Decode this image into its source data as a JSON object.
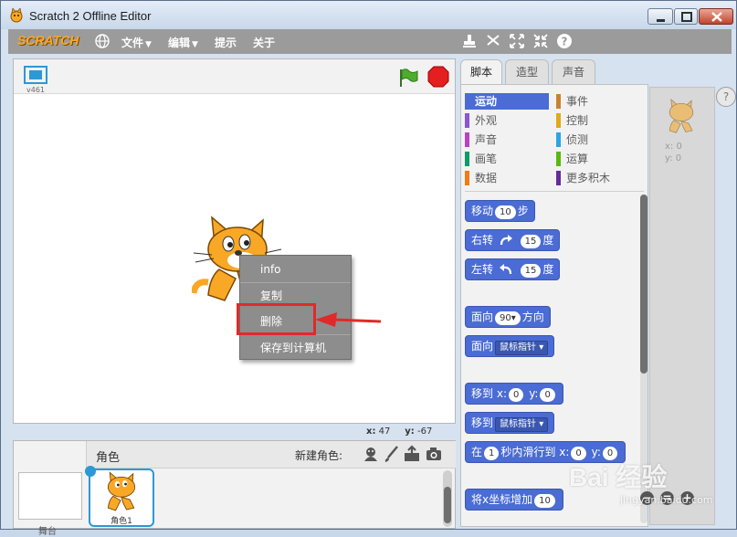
{
  "window": {
    "title": "Scratch 2 Offline Editor"
  },
  "menubar": {
    "logo": "SCRATCH",
    "items": [
      "文件",
      "编辑",
      "提示",
      "关于"
    ]
  },
  "stage": {
    "version": "v461",
    "coords": {
      "x_label": "x:",
      "x_value": "47",
      "y_label": "y:",
      "y_value": "-67"
    }
  },
  "context_menu": {
    "items": [
      "info",
      "复制",
      "删除",
      "保存到计算机"
    ],
    "highlighted_item": "删除",
    "annotation_color": "#e02a2a"
  },
  "sprites_panel": {
    "header": "角色",
    "new_sprite_label": "新建角色:",
    "sprite_name": "角色1",
    "stage_label": "舞台"
  },
  "tabs": [
    "脚本",
    "造型",
    "声音"
  ],
  "categories": [
    {
      "name": "运动",
      "color": "#4a6cd4",
      "selected": true
    },
    {
      "name": "事件",
      "color": "#c88330",
      "selected": false
    },
    {
      "name": "外观",
      "color": "#8a55d7",
      "selected": false
    },
    {
      "name": "控制",
      "color": "#e1a91a",
      "selected": false
    },
    {
      "name": "声音",
      "color": "#bb42c3",
      "selected": false
    },
    {
      "name": "侦测",
      "color": "#2ca5e2",
      "selected": false
    },
    {
      "name": "画笔",
      "color": "#0e9a6c",
      "selected": false
    },
    {
      "name": "运算",
      "color": "#5cb712",
      "selected": false
    },
    {
      "name": "数据",
      "color": "#ee7d16",
      "selected": false
    },
    {
      "name": "更多积木",
      "color": "#632d99",
      "selected": false
    }
  ],
  "blocks": {
    "move": {
      "label": "移动",
      "value": "10",
      "suffix": "步"
    },
    "turn_right": {
      "label": "右转",
      "value": "15",
      "suffix": "度"
    },
    "turn_left": {
      "label": "左转",
      "value": "15",
      "suffix": "度"
    },
    "point_direction": {
      "label": "面向",
      "value": "90▾",
      "suffix": "方向"
    },
    "point_towards": {
      "label": "面向",
      "value": "鼠标指针"
    },
    "goto_xy": {
      "label": "移到",
      "x_label": "x:",
      "x_value": "0",
      "y_label": "y:",
      "y_value": "0"
    },
    "goto": {
      "label": "移到",
      "value": "鼠标指针"
    },
    "glide": {
      "prefix": "在",
      "secs": "1",
      "mid": "秒内滑行到",
      "x_label": "x:",
      "x_value": "0",
      "y_label": "y:",
      "y_value": "0"
    },
    "change_x": {
      "label": "将x坐标增加",
      "value": "10"
    }
  },
  "scripts_area": {
    "x_readout": "x: 0",
    "y_readout": "y: 0",
    "help": "?"
  },
  "watermark": {
    "brand": "Bai 经验",
    "url": "jingyan.baidu.com"
  }
}
